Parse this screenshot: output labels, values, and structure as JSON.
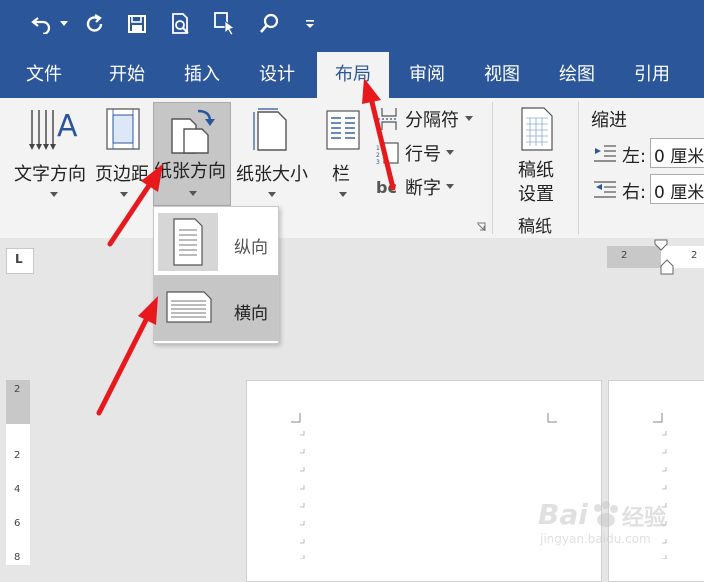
{
  "quick_access": {
    "undo_icon": "undo-icon",
    "redo_icon": "redo-icon",
    "save_icon": "save-icon",
    "print_preview_icon": "print-preview-icon",
    "touch_mode_icon": "touch-mode-icon",
    "search_icon": "search-icon",
    "customize_icon": "customize-icon"
  },
  "tabs": [
    "文件",
    "开始",
    "插入",
    "设计",
    "布局",
    "审阅",
    "视图",
    "绘图",
    "引用"
  ],
  "active_tab": "布局",
  "ribbon": {
    "text_direction": "文字方向",
    "margins": "页边距",
    "orientation": "纸张方向",
    "size": "纸张大小",
    "columns": "栏",
    "breaks": "分隔符",
    "line_numbers": "行号",
    "hyphenation": "断字",
    "hyphenation_icon_text": "bc",
    "manuscript_setup_line1": "稿纸",
    "manuscript_setup_line2": "设置",
    "manuscript_group": "稿纸",
    "indent_label": "缩进",
    "indent_left_label": "左:",
    "indent_left_value": "0 厘米",
    "indent_right_label": "右:",
    "indent_right_value": "0 厘米"
  },
  "orientation_menu": {
    "portrait": "纵向",
    "landscape": "横向",
    "selected": "横向"
  },
  "ruler": {
    "corner_glyph": "L",
    "h_marks": [
      "2",
      "2"
    ],
    "v_marks": [
      "2",
      "2",
      "4",
      "6",
      "8"
    ]
  },
  "watermark": {
    "brand": "Bai",
    "brand2": "经验",
    "url": "jingyan.baidu.com"
  },
  "colors": {
    "title_bar": "#2b579a",
    "ribbon_bg": "#f3f3f3",
    "highlight": "#c6c6c6",
    "arrow": "#e8191c"
  }
}
